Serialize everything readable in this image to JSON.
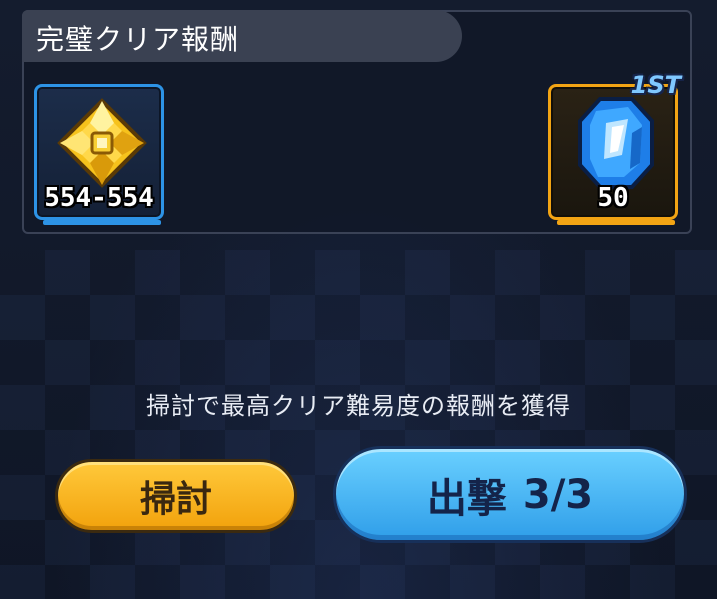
{
  "reward_panel": {
    "title": "完璧クリア報酬",
    "rewards": [
      {
        "icon": "gold-gem-crest-icon",
        "count": "554-554",
        "frame_color": "#2d93e6"
      },
      {
        "icon": "blue-crystal-icon",
        "count": "50",
        "badge": "1ST",
        "frame_color": "#f2a414"
      }
    ]
  },
  "info_text": "掃討で最高クリア難易度の報酬を獲得",
  "buttons": {
    "sweep_label": "掃討",
    "sortie_label": "出撃",
    "sortie_count": "3/3"
  },
  "colors": {
    "sweep_button": "#f2a20c",
    "sortie_button": "#3aa8ee",
    "background": "#121a2c"
  }
}
